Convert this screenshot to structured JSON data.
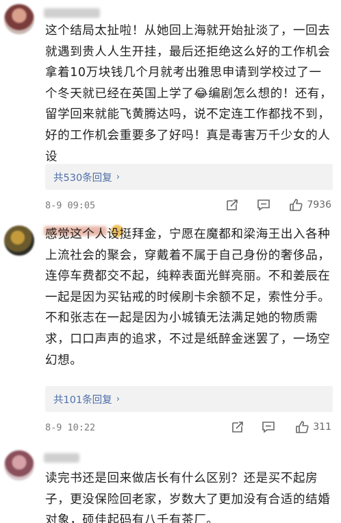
{
  "comments": [
    {
      "text": "这个结局太扯啦！从她回上海就开始扯淡了，一回去就遇到贵人人生开挂，最后还拒绝这么好的工作机会拿着10万块钱几个月就考出雅思申请到学校过了一个冬天就已经在英国上学了😂编剧怎么想的！还有，留学回来就能飞黄腾达吗，说不定连工作都找不到，好的工作机会重要多了好吗！真是毒害万千少女的人设",
      "replies": "共530条回复",
      "date": "8-9 09:05",
      "likes": "7936"
    },
    {
      "text": "感觉这个人设挺拜金，宁愿在魔都和梁海王出入各种上流社会的聚会，穿戴着不属于自己身份的奢侈品，连停车费都交不起，纯粹表面光鲜亮丽。不和姜辰在一起是因为买钻戒的时候刷卡余额不足，索性分手。不和张志在一起是因为小城镇无法满足她的物质需求，口口声声的追求，不过是纸醉金迷罢了，一场空幻想。",
      "replies": "共101条回复",
      "date": "8-9 10:22",
      "likes": "311"
    },
    {
      "text": "读完书还是回来做店长有什么区别？还是买不起房子，更没保险回老家，岁数大了更加没有合适的结婚对象，硕佳起码有八千有茶厂。"
    }
  ],
  "colors": {
    "link": "#4d6fa8",
    "meta": "#7a7a7a",
    "reply_bg": "#f2f2f2"
  },
  "icons": [
    "share-icon",
    "comment-icon",
    "like-icon"
  ]
}
